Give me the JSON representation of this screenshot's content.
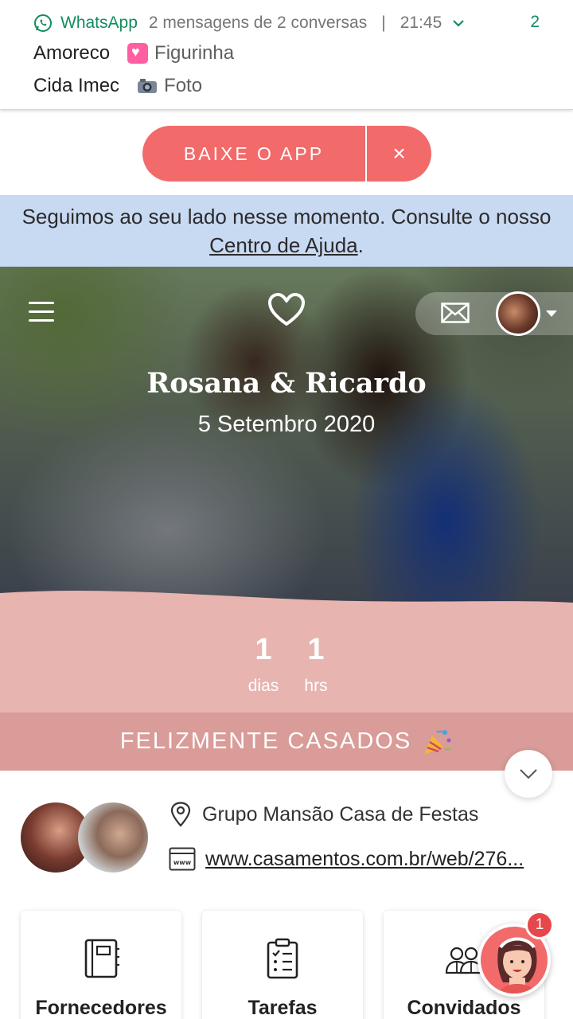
{
  "notification": {
    "app_name": "WhatsApp",
    "summary": "2 mensagens de 2 conversas",
    "separator": "|",
    "time": "21:45",
    "count": "2",
    "messages": [
      {
        "sender": "Amoreco",
        "text": "Figurinha",
        "icon": "heart-sticker-emoji"
      },
      {
        "sender": "Cida Imec",
        "text": "Foto",
        "icon": "camera-emoji"
      }
    ]
  },
  "app_banner": {
    "label": "BAIXE O APP",
    "close": "×"
  },
  "help_bar": {
    "text_before": "Seguimos ao seu lado nesse momento. Consulte o nosso ",
    "link": "Centro de Ajuda",
    "text_after": "."
  },
  "hero": {
    "couple": "Rosana & Ricardo",
    "date": "5 Setembro 2020"
  },
  "countdown": {
    "days_value": "1",
    "days_label": "dias",
    "hours_value": "1",
    "hours_label": "hrs"
  },
  "status_banner": "FELIZMENTE CASADOS",
  "info": {
    "venue": "Grupo Mansão Casa de Festas",
    "website": "www.casamentos.com.br/web/276..."
  },
  "cards": [
    {
      "label": "Fornecedores",
      "icon": "notebook-icon"
    },
    {
      "label": "Tarefas",
      "icon": "checklist-icon"
    },
    {
      "label": "Convidados",
      "icon": "guests-icon"
    }
  ],
  "assistant": {
    "badge": "1"
  },
  "colors": {
    "accent": "#f26a6a",
    "help_bg": "#c8d9f2",
    "countdown_bg": "#e8b4b0",
    "status_bg": "#d99c98",
    "whatsapp_green": "#128c5e"
  }
}
